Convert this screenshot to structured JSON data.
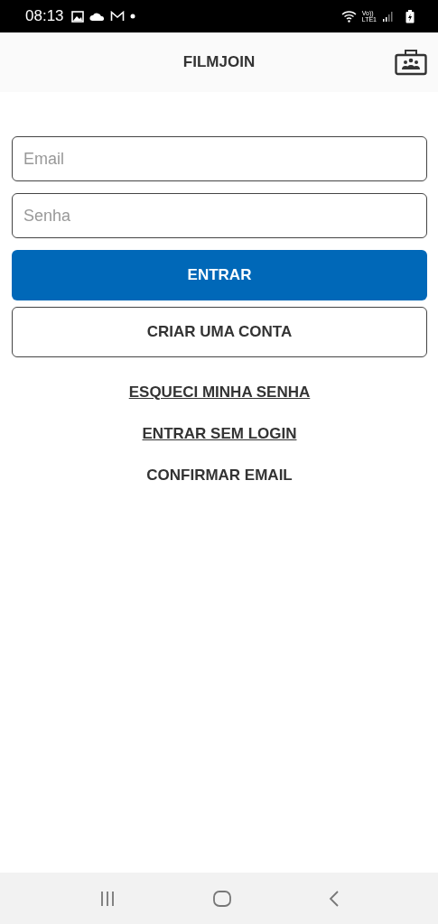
{
  "status_bar": {
    "time": "08:13",
    "network_top": "Vo))",
    "network_bottom": "LTE1"
  },
  "header": {
    "title": "FILMJOIN"
  },
  "fields": [
    {
      "placeholder": "Email"
    },
    {
      "placeholder": "Senha"
    }
  ],
  "buttons": [
    {
      "label": "ENTRAR",
      "kind": "primary"
    },
    {
      "label": "CRIAR UMA CONTA",
      "kind": "outline"
    }
  ],
  "links": [
    {
      "label": "ESQUECI MINHA SENHA",
      "underlined": true
    },
    {
      "label": "ENTRAR SEM LOGIN",
      "underlined": true
    },
    {
      "label": "CONFIRMAR EMAIL",
      "underlined": false
    }
  ]
}
